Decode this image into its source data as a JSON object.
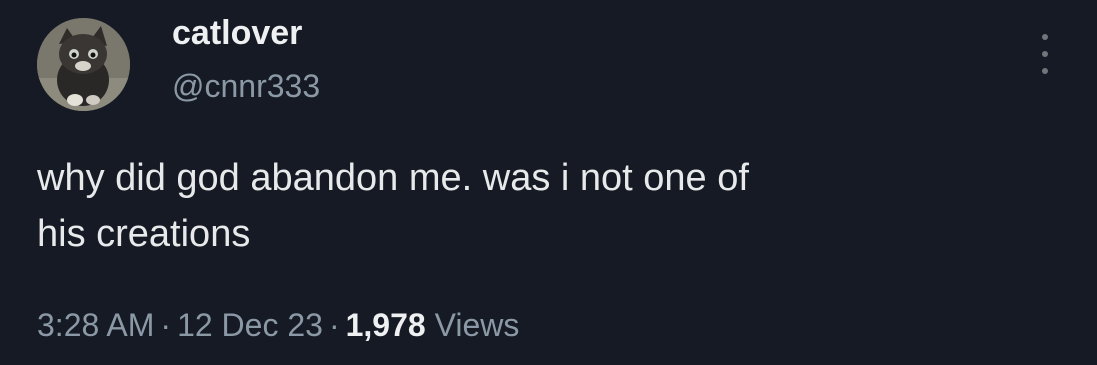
{
  "author": {
    "display_name": "catlover",
    "handle": "@cnnr333"
  },
  "tweet": {
    "line1": "why did god abandon me. was i not one of",
    "line2": "his creations"
  },
  "meta": {
    "time": "3:28 AM",
    "separator": "·",
    "date": "12 Dec 23",
    "views_count": "1,978",
    "views_label": "Views"
  },
  "icons": {
    "more": "more-vertical-icon",
    "avatar": "cat-photo"
  },
  "colors": {
    "background": "#151a24",
    "primary_text": "#e7e9ea",
    "secondary_text": "#8b98a5"
  }
}
